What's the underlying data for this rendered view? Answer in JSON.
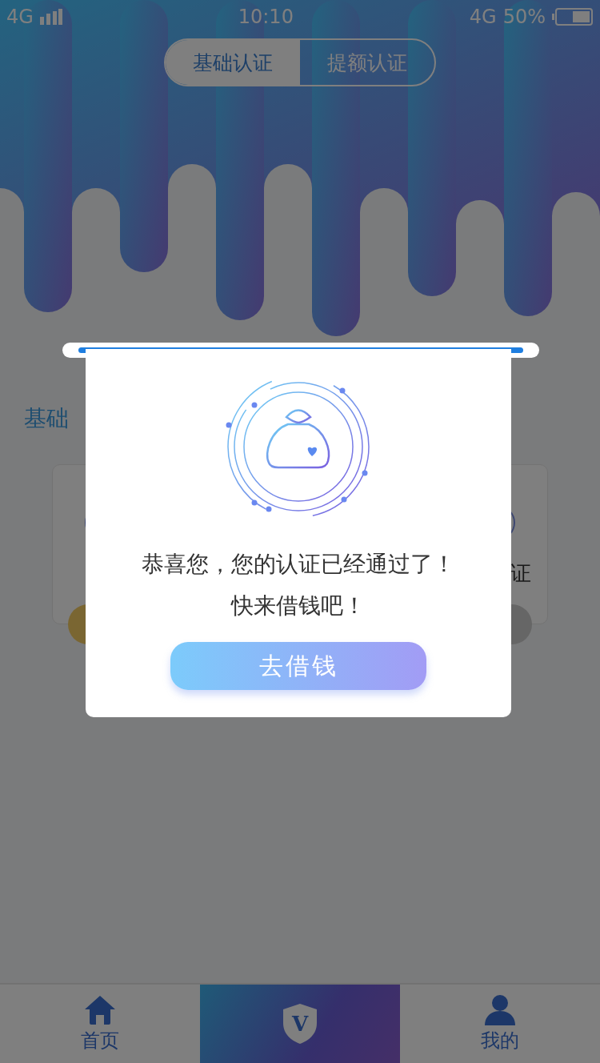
{
  "status_bar": {
    "network": "4G",
    "time": "10:10",
    "data_network": "4G",
    "battery": "50%"
  },
  "tabs": [
    {
      "label": "基础认证",
      "selected": true
    },
    {
      "label": "提额认证",
      "selected": false
    }
  ],
  "section": {
    "title": "基础"
  },
  "cards": [
    {
      "color": "#7a6632"
    },
    {
      "label": "证",
      "color": "#666666"
    }
  ],
  "dialog": {
    "message": "恭喜您，您的认证已经通过了！",
    "sub_message": "快来借钱吧！",
    "button": "去借钱"
  },
  "bottom_nav": [
    {
      "kind": "tab",
      "label": "首页",
      "selected": false
    },
    {
      "kind": "center",
      "label": "V",
      "selected": true
    },
    {
      "kind": "tab",
      "label": "我的",
      "selected": false
    }
  ]
}
